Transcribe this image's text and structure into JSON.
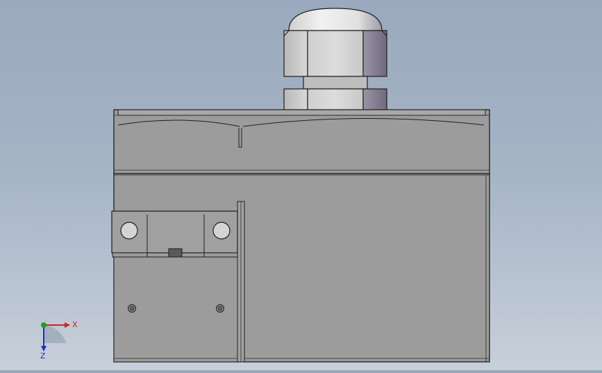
{
  "triad": {
    "x_label": "X",
    "z_label": "Z",
    "colors": {
      "x": "#d02020",
      "y": "#20a020",
      "z": "#2030c0"
    }
  },
  "palette": {
    "body": "#9c9c9c",
    "body_dark": "#8a8a8a",
    "outline": "#1e1e1e",
    "gland_light": "#e8e8e8",
    "gland_mid": "#c4c4c4",
    "gland_dark": "#7a7a88"
  }
}
